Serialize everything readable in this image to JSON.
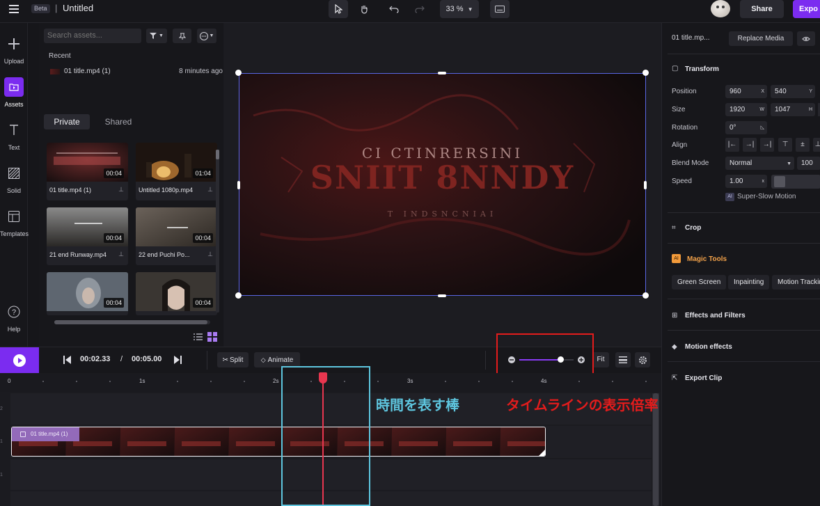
{
  "topbar": {
    "beta": "Beta",
    "separator": "|",
    "title": "Untitled",
    "zoom": "33 %",
    "share": "Share",
    "export": "Expo"
  },
  "rail": [
    {
      "label": "Upload",
      "icon": "plus-icon"
    },
    {
      "label": "Assets",
      "icon": "folder-icon"
    },
    {
      "label": "Text",
      "icon": "text-icon"
    },
    {
      "label": "Solid",
      "icon": "pattern-icon"
    },
    {
      "label": "Templates",
      "icon": "layout-icon"
    },
    {
      "label": "Help",
      "icon": "question-icon"
    }
  ],
  "assets": {
    "search_placeholder": "Search assets...",
    "recent_label": "Recent",
    "recent_item": {
      "name": "01 title.mp4 (1)",
      "time": "8 minutes ago"
    },
    "tabs": [
      "Private",
      "Shared"
    ],
    "items": [
      {
        "name": "01 title.mp4 (1)",
        "duration": "00:04"
      },
      {
        "name": "Untitled 1080p.mp4",
        "duration": "01:04"
      },
      {
        "name": "21 end Runway.mp4",
        "duration": "00:04"
      },
      {
        "name": "22 end Puchi Po...",
        "duration": "00:04"
      },
      {
        "name": "",
        "duration": "00:04"
      },
      {
        "name": "",
        "duration": "00:04"
      }
    ]
  },
  "preview": {
    "line1": "CI CTINRERSINI",
    "line2": "SNIIT 8NNDY",
    "line3": "T INDSNCNIAI"
  },
  "props": {
    "file_name": "01 title.mp...",
    "replace_media": "Replace Media",
    "transform_title": "Transform",
    "position_label": "Position",
    "position_x": "960",
    "position_y": "540",
    "size_label": "Size",
    "size_w": "1920",
    "size_h": "1047",
    "rotation_label": "Rotation",
    "rotation_value": "0°",
    "align_label": "Align",
    "blend_label": "Blend Mode",
    "blend_value": "Normal",
    "opacity_value": "100",
    "speed_label": "Speed",
    "speed_value": "1.00",
    "super_slow": "Super-Slow Motion",
    "crop": "Crop",
    "magic_tools": "Magic Tools",
    "magic_ai": "AI",
    "chips": [
      "Green Screen",
      "Inpainting",
      "Motion Trackin"
    ],
    "effects": "Effects and Filters",
    "motion_effects": "Motion effects",
    "export_clip": "Export Clip",
    "suffix_x": "X",
    "suffix_y": "Y",
    "suffix_w": "W",
    "suffix_h": "H"
  },
  "timeline": {
    "current_time": "00:02.33",
    "time_sep": "/",
    "total_time": "00:05.00",
    "split": "Split",
    "animate": "Animate",
    "fit": "Fit",
    "ticks": [
      "0",
      "1s",
      "2s",
      "3s",
      "4s"
    ],
    "clip_label": "01 title.mp4 (1)",
    "zoom_level": 0.75
  },
  "annotations": {
    "playhead_note": "時間を表す棒",
    "zoom_note": "タイムラインの表示倍率"
  },
  "colors": {
    "accent": "#7b2cf0",
    "playhead": "#e8364f",
    "annotation_blue": "#5ec6df",
    "annotation_red": "#e41c1c",
    "selection": "#5a67e6"
  }
}
